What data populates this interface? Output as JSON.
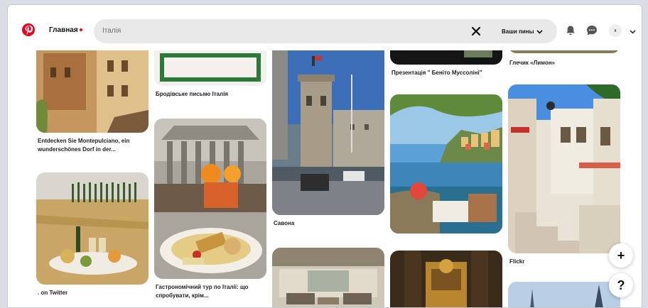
{
  "header": {
    "home_label": "Главная",
    "search_value": "Італія",
    "pins_dropdown_label": "Ваши пины",
    "avatar_initial": "к"
  },
  "pins": {
    "p1": {
      "title": "Entdecken Sie Montepulciano, ein wunderschönes Dorf in der..."
    },
    "p2": {
      "title": ". on Twitter"
    },
    "p3": {
      "title": "Бродівське письмо Італія"
    },
    "p4": {
      "title": "Гастрономічний тур по Італії: що спробувати, крім..."
    },
    "p5": {
      "title": "Савона"
    },
    "p6": {
      "title": ""
    },
    "p7": {
      "title": "Презентація \" Беніто Муссоліні\""
    },
    "p8": {
      "title": ""
    },
    "p9": {
      "title": ""
    },
    "p10": {
      "title": "Глечик «Лимон»"
    },
    "p11": {
      "title": "Flickr"
    },
    "p12": {
      "title": ""
    }
  },
  "fab": {
    "add": "+",
    "help": "?"
  },
  "colors": {
    "brand": "#e60023",
    "search_bg": "#e9e9e9"
  }
}
